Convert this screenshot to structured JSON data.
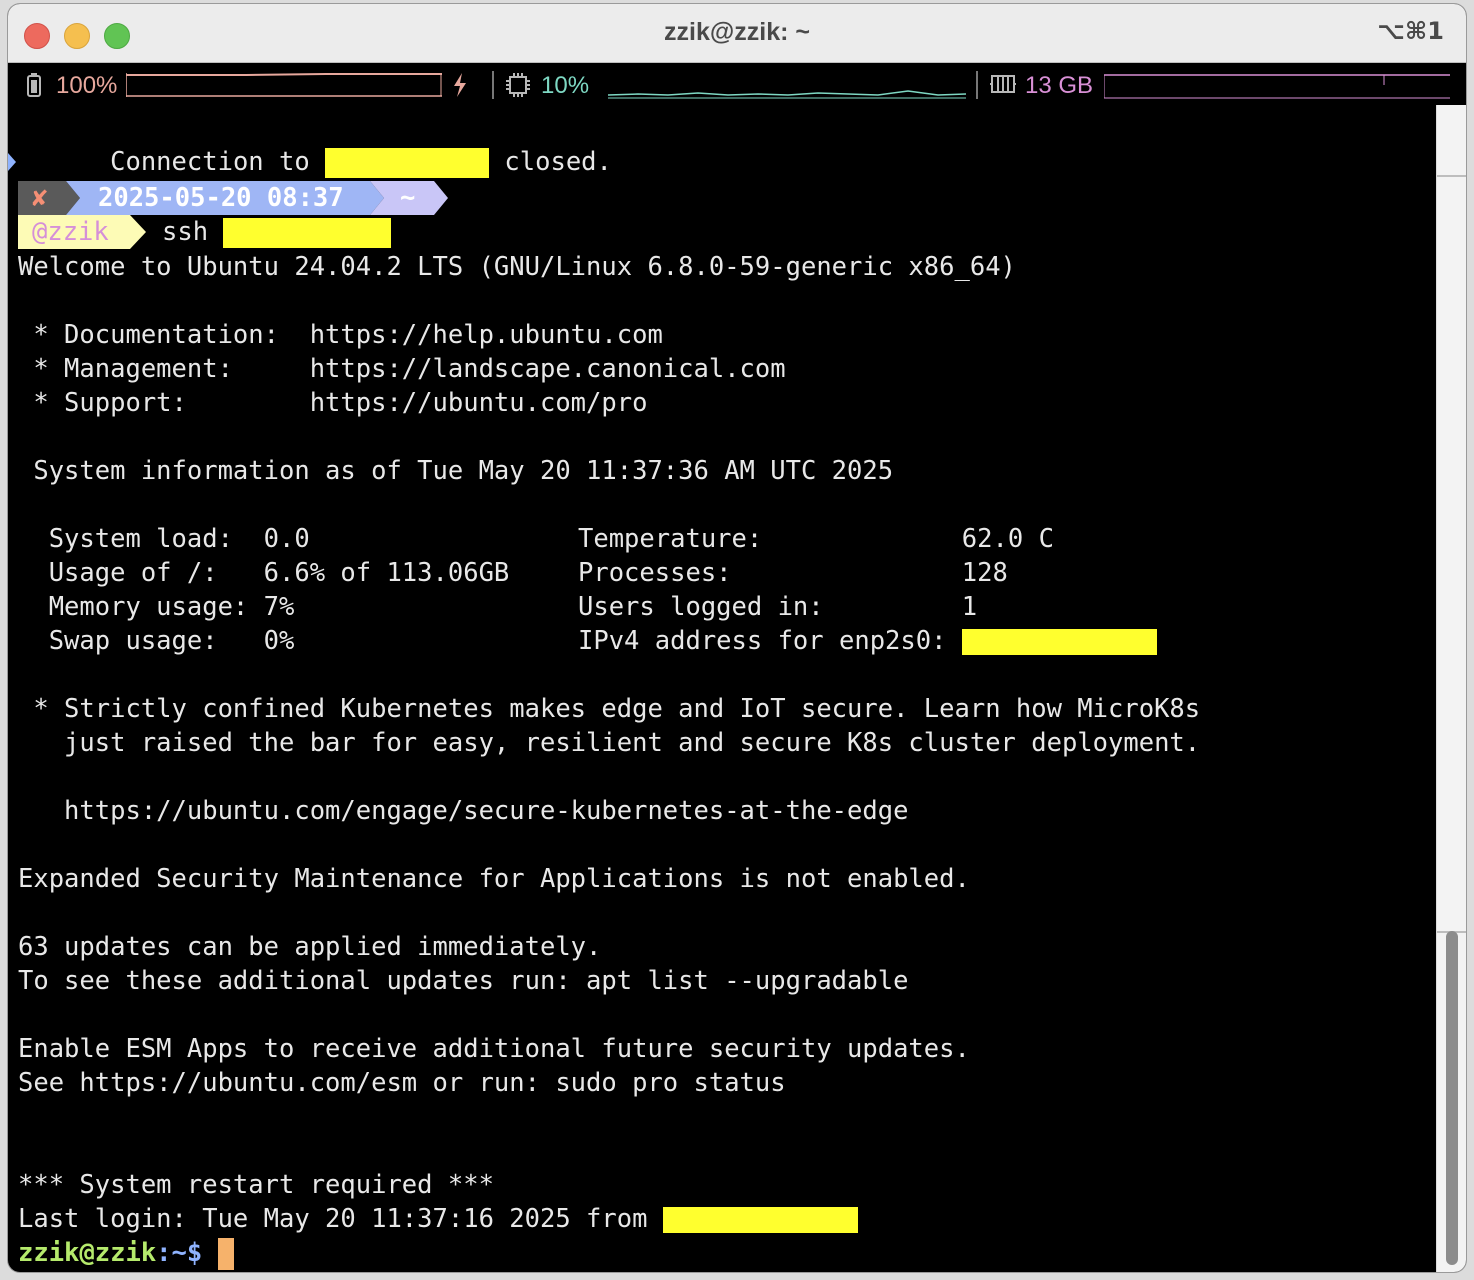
{
  "window": {
    "title": "zzik@zzik: ~",
    "shortcut": "⌥⌘1"
  },
  "status": {
    "battery_icon": "battery-icon",
    "battery": "100%",
    "charging_icon": "bolt-icon",
    "cpu_icon": "cpu-chip-icon",
    "cpu": "10%",
    "mem_icon": "memory-icon",
    "mem": "13 GB"
  },
  "lines": {
    "conn_a": "Connection to ",
    "conn_b": " closed.",
    "prompt_status": "✘",
    "prompt_date": "2025-05-20 08:37",
    "prompt_dir": "~",
    "prompt_user": "@zzik",
    "prompt_cmd": "ssh ",
    "welcome": "Welcome to Ubuntu 24.04.2 LTS (GNU/Linux 6.8.0-59-generic x86_64)",
    "doc": " * Documentation:  https://help.ubuntu.com",
    "mgmt": " * Management:     https://landscape.canonical.com",
    "support": " * Support:        https://ubuntu.com/pro",
    "sysinfo": " System information as of Tue May 20 11:37:36 AM UTC 2025",
    "load_l": "  System load:  0.0",
    "load_r": "Temperature:             62.0 C",
    "usage_l": "  Usage of /:   6.6% of 113.06GB",
    "usage_r": "Processes:               128",
    "mem_l": "  Memory usage: 7%",
    "mem_r": "Users logged in:         1",
    "swap_l": "  Swap usage:   0%",
    "swap_r": "IPv4 address for enp2s0: ",
    "k8s1": " * Strictly confined Kubernetes makes edge and IoT secure. Learn how MicroK8s",
    "k8s2": "   just raised the bar for easy, resilient and secure K8s cluster deployment.",
    "k8s3": "   https://ubuntu.com/engage/secure-kubernetes-at-the-edge",
    "esm": "Expanded Security Maintenance for Applications is not enabled.",
    "upd1": "63 updates can be applied immediately.",
    "upd2": "To see these additional updates run: apt list --upgradable",
    "esm1": "Enable ESM Apps to receive additional future security updates.",
    "esm2": "See https://ubuntu.com/esm or run: sudo pro status",
    "restart": "*** System restart required ***",
    "lastlogin": "Last login: Tue May 20 11:37:16 2025 from ",
    "ps1_user": "zzik@zzik",
    "ps1_path": ":~$ "
  },
  "colors": {
    "prompt_status_bg": "#5a5a5a",
    "prompt_date_bg": "#9fb6f5",
    "prompt_dir_bg": "#c9c6f7",
    "prompt_user_bg": "#fdfbb6",
    "prompt_user_fg": "#d58fd8",
    "ps1_user": "#b5ea6c",
    "ps1_path": "#8fb3ff",
    "redaction": "#ffff2e"
  }
}
